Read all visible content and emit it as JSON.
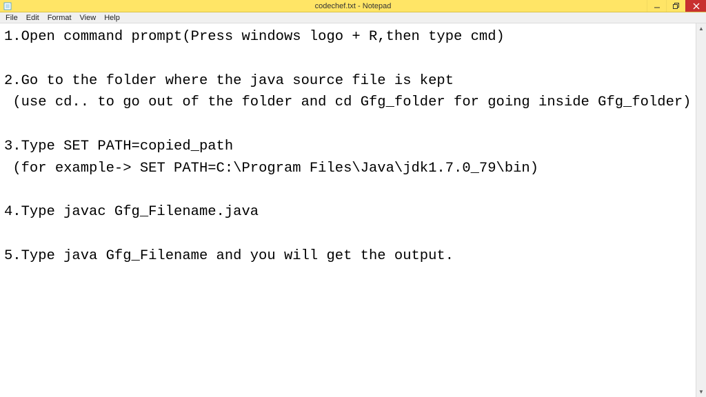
{
  "window": {
    "title": "codechef.txt - Notepad"
  },
  "menu": {
    "file": "File",
    "edit": "Edit",
    "format": "Format",
    "view": "View",
    "help": "Help"
  },
  "document": {
    "text": "1.Open command prompt(Press windows logo + R,then type cmd)\n\n2.Go to the folder where the java source file is kept\n (use cd.. to go out of the folder and cd Gfg_folder for going inside Gfg_folder)\n\n3.Type SET PATH=copied_path\n (for example-> SET PATH=C:\\Program Files\\Java\\jdk1.7.0_79\\bin)\n\n4.Type javac Gfg_Filename.java\n\n5.Type java Gfg_Filename and you will get the output."
  }
}
